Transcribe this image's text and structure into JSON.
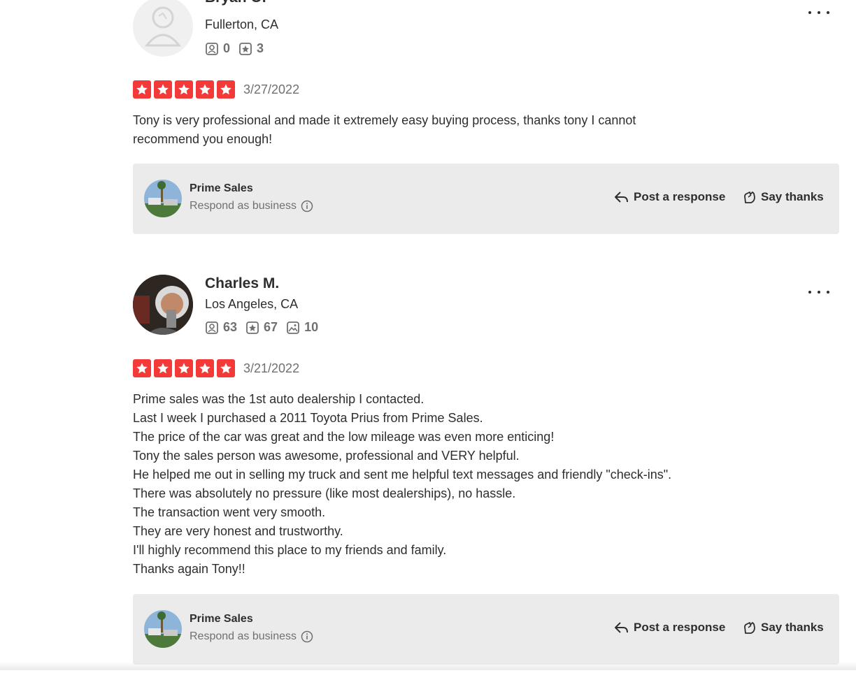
{
  "reviews": [
    {
      "user": {
        "name": "Bryan O.",
        "location": "Fullerton, CA",
        "stats": [
          {
            "icon": "friends-icon",
            "value": "0"
          },
          {
            "icon": "reviews-icon",
            "value": "3"
          }
        ]
      },
      "rating": 5,
      "date": "3/27/2022",
      "text": "Tony is very professional and made it extremely easy buying process, thanks tony I cannot\nrecommend you enough!",
      "business": {
        "name": "Prime Sales",
        "respond_label": "Respond as business",
        "post_response_label": "Post a response",
        "say_thanks_label": "Say thanks"
      }
    },
    {
      "user": {
        "name": "Charles M.",
        "location": "Los Angeles, CA",
        "stats": [
          {
            "icon": "friends-icon",
            "value": "63"
          },
          {
            "icon": "reviews-icon",
            "value": "67"
          },
          {
            "icon": "photos-icon",
            "value": "10"
          }
        ]
      },
      "rating": 5,
      "date": "3/21/2022",
      "text": "Prime sales was the 1st auto dealership I contacted.\nLast I week I purchased a 2011 Toyota Prius from Prime Sales.\nThe price of the car was great and the low mileage was even more enticing!\nTony the sales person was awesome, professional and VERY helpful.\nHe helped me out in selling my truck and sent me helpful text messages and friendly \"check-ins\".\nThere was absolutely no pressure (like most dealerships), no hassle.\nThe transaction went very smooth.\nThey are very honest and trustworthy.\nI'll highly recommend this place to my friends and family.\nThanks again Tony!!",
      "business": {
        "name": "Prime Sales",
        "respond_label": "Respond as business",
        "post_response_label": "Post a response",
        "say_thanks_label": "Say thanks"
      }
    }
  ],
  "colors": {
    "star": "#f43939",
    "text": "#2d2e2f",
    "muted": "#6e7072",
    "panel": "#ebebeb"
  }
}
